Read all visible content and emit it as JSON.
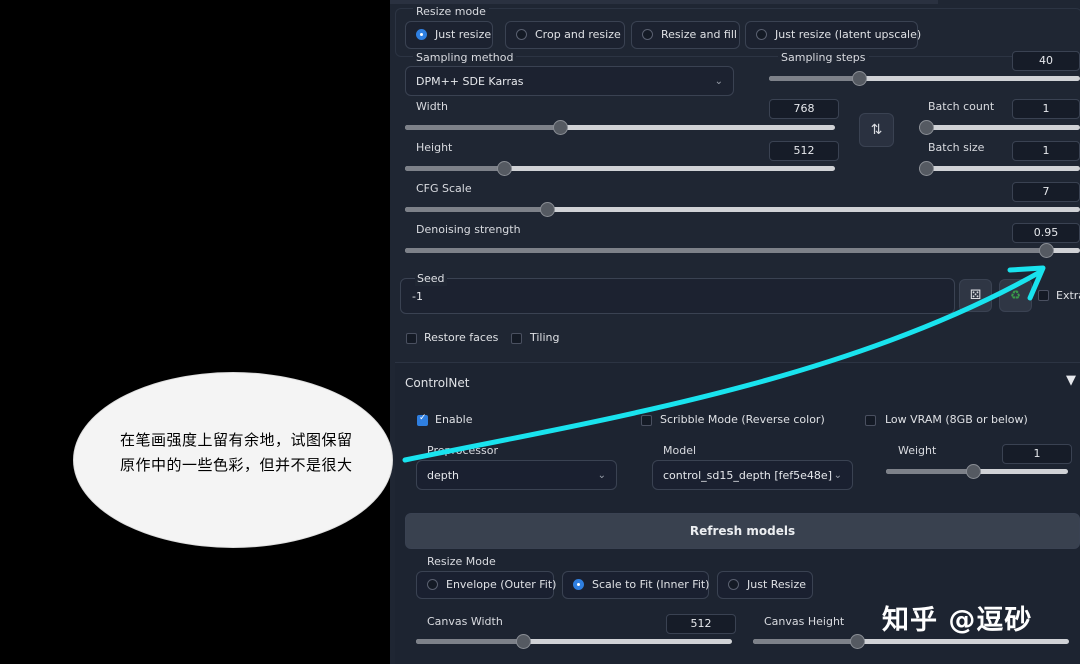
{
  "img2img": {
    "resize_mode_label": "Resize mode",
    "resize_modes": [
      {
        "label": "Just resize",
        "selected": true
      },
      {
        "label": "Crop and resize",
        "selected": false
      },
      {
        "label": "Resize and fill",
        "selected": false
      },
      {
        "label": "Just resize (latent upscale)",
        "selected": false
      }
    ],
    "sampling_method_label": "Sampling method",
    "sampling_method_value": "DPM++ SDE Karras",
    "sampling_steps_label": "Sampling steps",
    "sampling_steps_value": "40",
    "sampling_steps_fraction": 0.29,
    "width_label": "Width",
    "width_value": "768",
    "width_fraction": 0.36,
    "height_label": "Height",
    "height_value": "512",
    "height_fraction": 0.23,
    "batch_count_label": "Batch count",
    "batch_count_value": "1",
    "batch_size_label": "Batch size",
    "batch_size_value": "1",
    "cfg_scale_label": "CFG Scale",
    "cfg_scale_value": "7",
    "cfg_fraction": 0.21,
    "denoising_label": "Denoising strength",
    "denoising_value": "0.95",
    "denoising_fraction": 0.95,
    "seed_label": "Seed",
    "seed_value": "-1",
    "extra_label": "Extra",
    "restore_faces_label": "Restore faces",
    "tiling_label": "Tiling"
  },
  "controlnet": {
    "title": "ControlNet",
    "enable_label": "Enable",
    "scribble_label": "Scribble Mode (Reverse color)",
    "lowvram_label": "Low VRAM (8GB or below)",
    "preprocessor_label": "Preprocessor",
    "preprocessor_value": "depth",
    "model_label": "Model",
    "model_value": "control_sd15_depth [fef5e48e]",
    "weight_label": "Weight",
    "weight_value": "1",
    "weight_fraction": 0.48,
    "refresh_label": "Refresh models",
    "resize_mode_label": "Resize Mode",
    "resize_modes": [
      {
        "label": "Envelope (Outer Fit)",
        "selected": false
      },
      {
        "label": "Scale to Fit (Inner Fit)",
        "selected": true
      },
      {
        "label": "Just Resize",
        "selected": false
      }
    ],
    "canvas_width_label": "Canvas Width",
    "canvas_width_value": "512",
    "canvas_width_fraction": 0.34,
    "canvas_height_label": "Canvas Height",
    "canvas_height_fraction": 0.33
  },
  "annotation": {
    "text": "在笔画强度上留有余地，试图保留原作中的一些色彩，但并不是很大",
    "arrow_color": "#19e3ee"
  },
  "watermark": "知乎 @逗砂"
}
